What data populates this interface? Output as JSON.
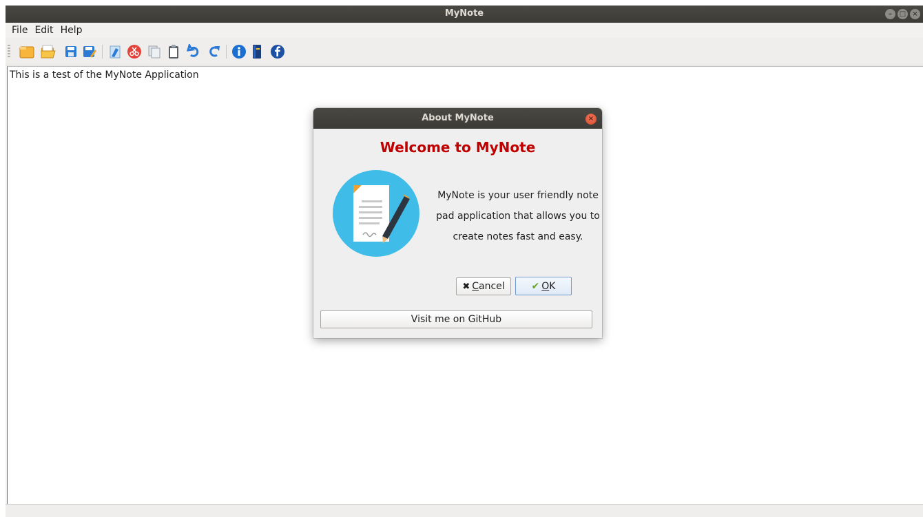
{
  "window": {
    "title": "MyNote"
  },
  "menu": {
    "items": [
      {
        "label": "File"
      },
      {
        "label": "Edit"
      },
      {
        "label": "Help"
      }
    ]
  },
  "toolbar": {
    "icons": [
      "new-file-icon",
      "open-folder-icon",
      "save-icon",
      "save-as-icon",
      "clear-icon",
      "cut-icon",
      "copy-icon",
      "paste-icon",
      "undo-icon",
      "redo-icon",
      "info-icon",
      "book-icon",
      "facebook-icon"
    ]
  },
  "editor": {
    "content": "This is a test of the MyNote Application"
  },
  "dialog": {
    "title": "About MyNote",
    "heading": "Welcome to MyNote",
    "description": "MyNote is your user friendly note pad application that allows you to create notes fast and easy.",
    "cancel_label": "Cancel",
    "cancel_mnemonic": "C",
    "cancel_rest": "ancel",
    "ok_label": "OK",
    "ok_mnemonic": "O",
    "ok_rest": "K",
    "github_label": "Visit me on GitHub",
    "heading_color": "#c00000"
  }
}
